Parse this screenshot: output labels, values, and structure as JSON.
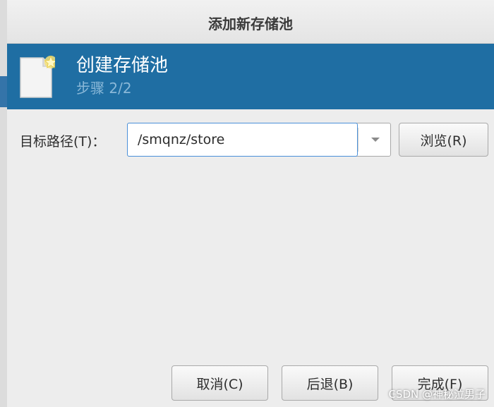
{
  "dialog": {
    "title": "添加新存储池"
  },
  "banner": {
    "title": "创建存储池",
    "step": "步骤 2/2",
    "icon": "new-document-icon"
  },
  "form": {
    "target_path_label": "目标路径(T)：",
    "target_path_value": "/smqnz/store",
    "browse_label": "浏览(R)",
    "dropdown_icon": "chevron-down-icon"
  },
  "footer": {
    "cancel_label": "取消(C)",
    "back_label": "后退(B)",
    "finish_label": "完成(F)"
  },
  "watermark": "CSDN @神秘泣男子",
  "colors": {
    "banner_bg": "#1f6ea3",
    "banner_step_text": "#8ab8d8",
    "focus_border": "#4a90d9",
    "window_bg": "#ededed"
  }
}
